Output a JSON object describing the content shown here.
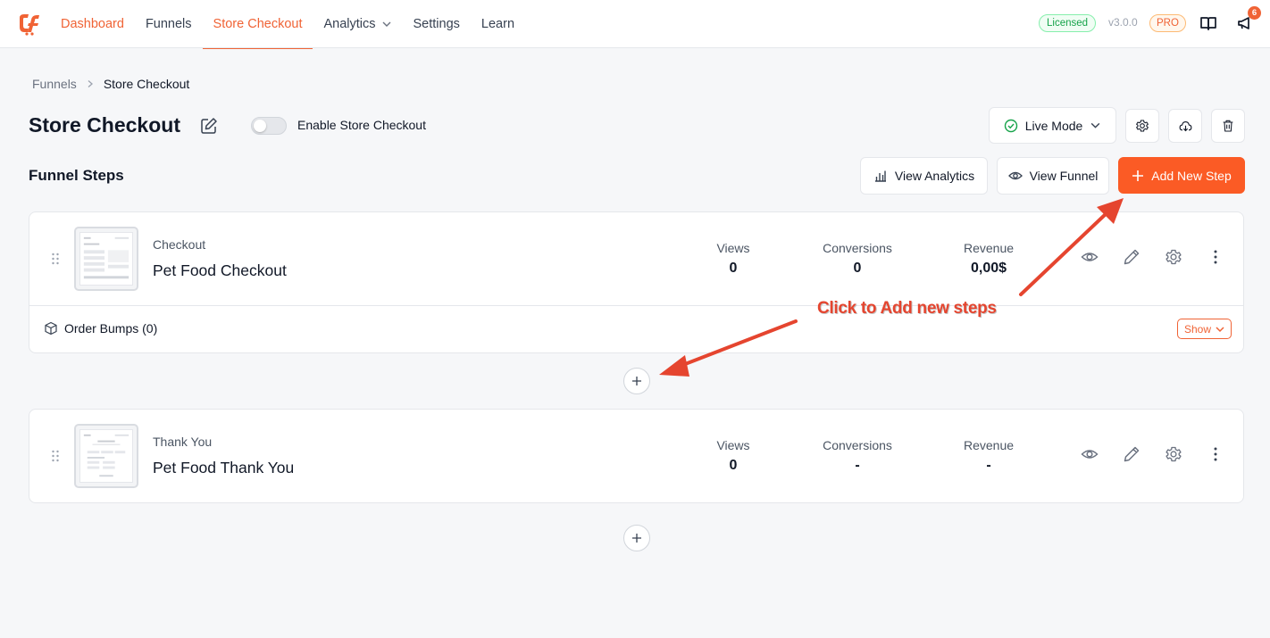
{
  "nav": {
    "items": [
      {
        "label": "Dashboard"
      },
      {
        "label": "Funnels"
      },
      {
        "label": "Store Checkout"
      },
      {
        "label": "Analytics"
      },
      {
        "label": "Settings"
      },
      {
        "label": "Learn"
      }
    ],
    "licensed_badge": "Licensed",
    "version": "v3.0.0",
    "pro_badge": "PRO",
    "notification_count": "6"
  },
  "breadcrumb": {
    "parent": "Funnels",
    "current": "Store Checkout"
  },
  "header": {
    "title": "Store Checkout",
    "toggle_label": "Enable Store Checkout",
    "mode_label": "Live Mode"
  },
  "steps_section": {
    "title": "Funnel Steps",
    "view_analytics_label": "View Analytics",
    "view_funnel_label": "View Funnel",
    "add_step_label": "Add New Step"
  },
  "steps": [
    {
      "type": "Checkout",
      "name": "Pet Food Checkout",
      "stats": {
        "views_label": "Views",
        "views": "0",
        "conversions_label": "Conversions",
        "conversions": "0",
        "revenue_label": "Revenue",
        "revenue": "0,00$"
      },
      "order_bumps_label": "Order Bumps (0)",
      "show_label": "Show"
    },
    {
      "type": "Thank You",
      "name": "Pet Food Thank You",
      "stats": {
        "views_label": "Views",
        "views": "0",
        "conversions_label": "Conversions",
        "conversions": "-",
        "revenue_label": "Revenue",
        "revenue": "-"
      }
    }
  ],
  "annotation": {
    "text": "Click to Add new steps",
    "color": "#e5452f"
  },
  "colors": {
    "brand": "#f06335",
    "primary_button": "#fb5b25"
  }
}
